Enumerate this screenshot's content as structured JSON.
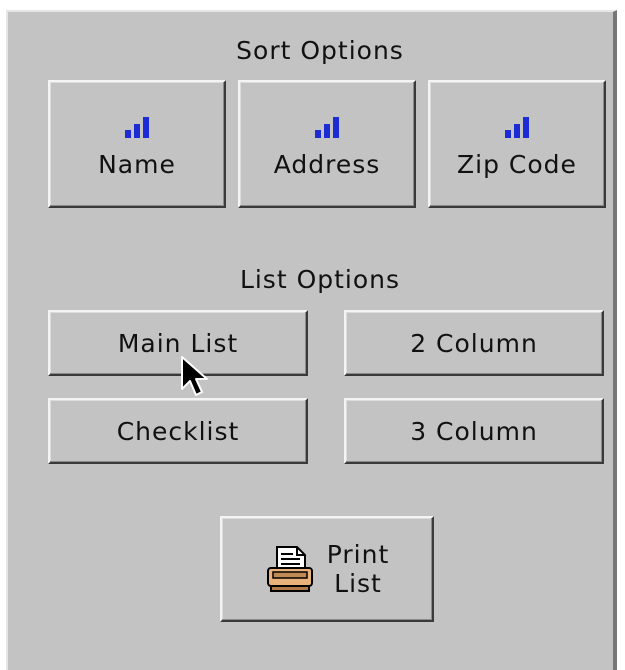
{
  "sort_options": {
    "title": "Sort Options",
    "buttons": [
      {
        "label": "Name",
        "icon": "signal-bars-icon"
      },
      {
        "label": "Address",
        "icon": "signal-bars-icon"
      },
      {
        "label": "Zip Code",
        "icon": "signal-bars-icon"
      }
    ]
  },
  "list_options": {
    "title": "List Options",
    "main_list": "Main List",
    "two_column": "2 Column",
    "checklist": "Checklist",
    "three_column": "3 Column"
  },
  "print": {
    "line1": "Print",
    "line2": "List",
    "icon": "printer-icon"
  },
  "colors": {
    "panel": "#c3c3c3",
    "icon_blue": "#1d2bd4"
  }
}
